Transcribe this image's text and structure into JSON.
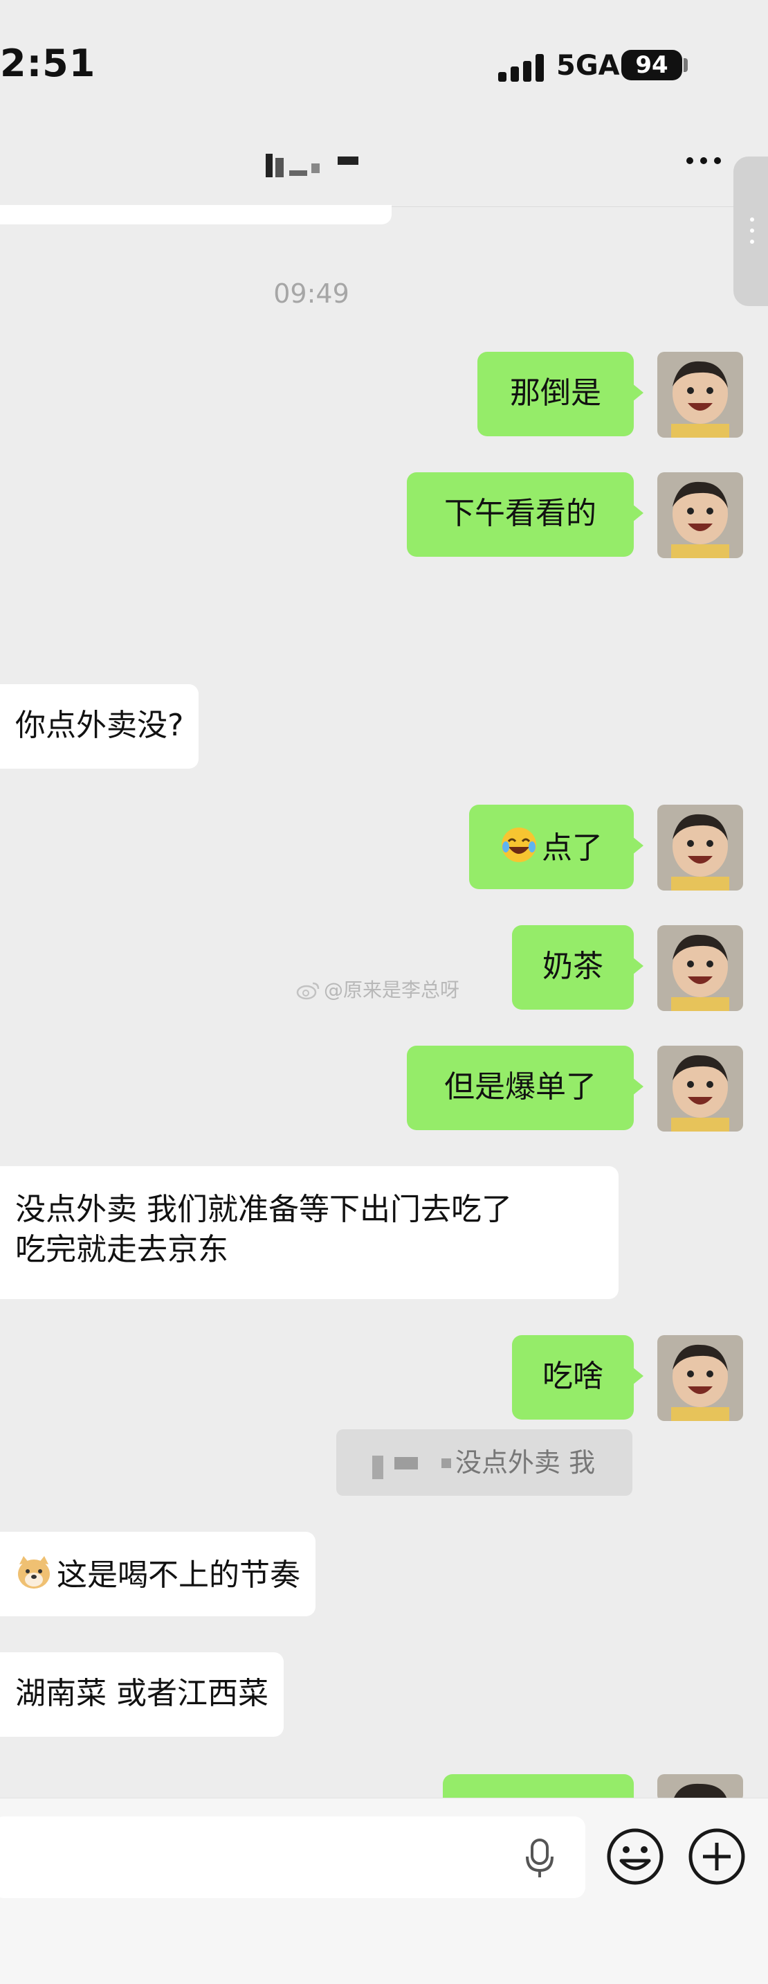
{
  "status_bar": {
    "time": "2:51",
    "network": "5GA",
    "battery": "94"
  },
  "chat": {
    "timestamp": "09:49",
    "messages": [
      {
        "side": "right",
        "text": "那倒是"
      },
      {
        "side": "right",
        "text": "下午看看的"
      },
      {
        "side": "left",
        "text": "你点外卖没?"
      },
      {
        "side": "right",
        "text": "点了",
        "emoji": "laughing-tears-emoji"
      },
      {
        "side": "right",
        "text": "奶茶"
      },
      {
        "side": "right",
        "text": "但是爆单了"
      },
      {
        "side": "left",
        "lines": [
          "没点外卖 我们就准备等下出门去吃了",
          "吃完就走去京东"
        ]
      },
      {
        "side": "right",
        "text": "吃啥"
      },
      {
        "side": "left",
        "text": "这是喝不上的节奏",
        "emoji": "doge-emoji"
      },
      {
        "side": "left",
        "text": "湖南菜  或者江西菜"
      }
    ],
    "quote": {
      "text": "没点外卖 我"
    },
    "watermark": "@原来是李总呀"
  },
  "input_bar": {
    "placeholder": ""
  },
  "colors": {
    "background": "#ededed",
    "own_bubble": "#95ec69",
    "other_bubble": "#ffffff",
    "timestamp": "#a6a6a6"
  },
  "icons": [
    "ellipsis-icon",
    "microphone-icon",
    "emoji-icon",
    "plus-icon",
    "avatar"
  ]
}
